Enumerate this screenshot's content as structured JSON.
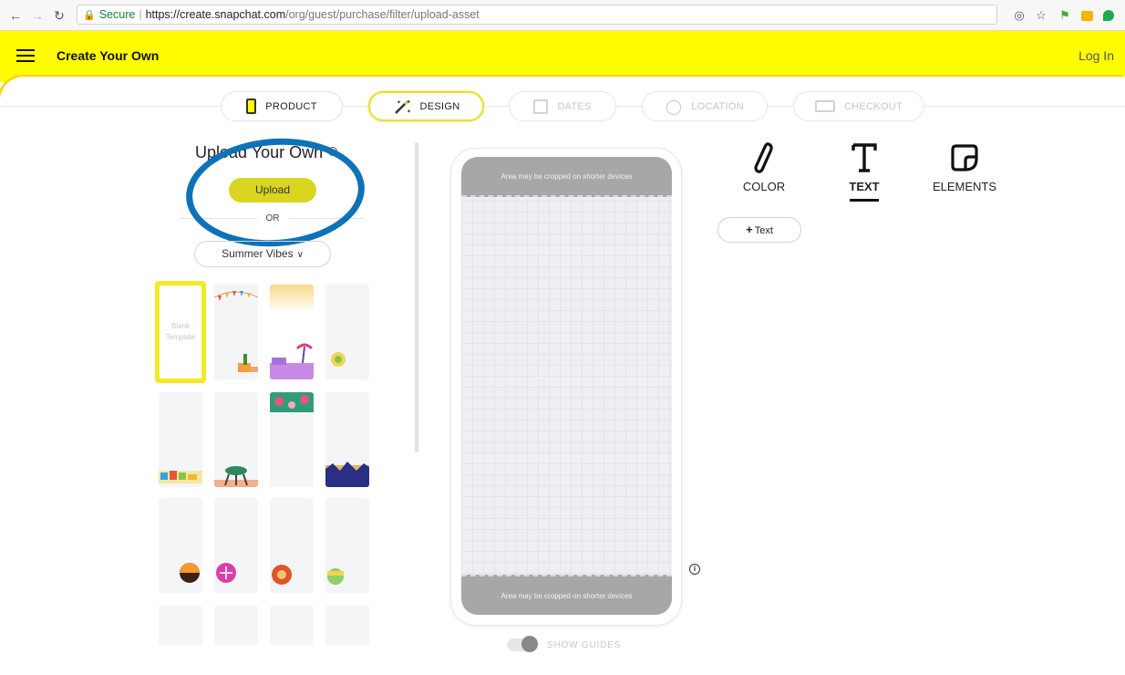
{
  "browser": {
    "secure_label": "Secure",
    "url_host": "https://create.snapchat.com",
    "url_path": "/org/guest/purchase/filter/upload-asset"
  },
  "header": {
    "brand": "Create Your Own",
    "login": "Log In",
    "color": "#fffc00"
  },
  "steps": [
    {
      "label": "PRODUCT",
      "icon": "phone-icon",
      "state": "done"
    },
    {
      "label": "DESIGN",
      "icon": "magic-wand-icon",
      "state": "active"
    },
    {
      "label": "DATES",
      "icon": "calendar-icon",
      "state": "disabled"
    },
    {
      "label": "LOCATION",
      "icon": "location-pin-icon",
      "state": "disabled"
    },
    {
      "label": "CHECKOUT",
      "icon": "card-icon",
      "state": "disabled"
    }
  ],
  "upload": {
    "title": "Upload Your Own",
    "button": "Upload",
    "or": "OR"
  },
  "theme": {
    "selected": "Summer Vibes"
  },
  "templates": {
    "blank_label_1": "Blank",
    "blank_label_2": "Template"
  },
  "preview": {
    "crop_top": "Area may be cropped on shorter devices",
    "crop_bottom": "Area may be cropped on shorter devices",
    "info": "i",
    "guides_label": "SHOW GUIDES"
  },
  "tools": {
    "color": "COLOR",
    "text": "TEXT",
    "elements": "ELEMENTS",
    "active": "TEXT",
    "add_text": "Text"
  },
  "accent": {
    "upload_button": "#d9d520",
    "selection": "#f2ea25",
    "annotation": "#0d72b8"
  }
}
